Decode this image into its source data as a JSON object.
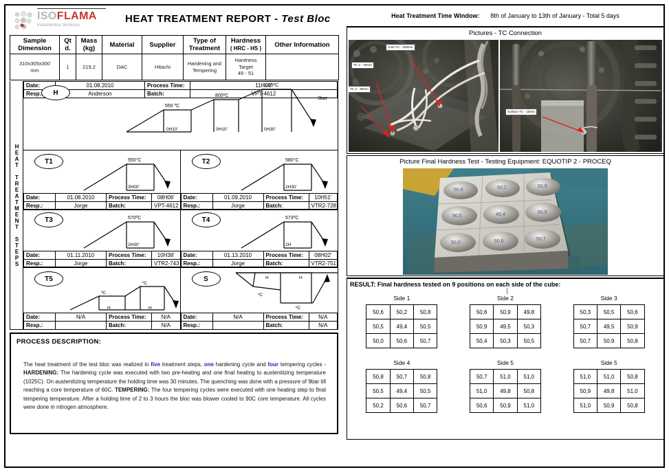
{
  "header": {
    "logo_main_part1": "ISO",
    "logo_main_part2": "FLAMA",
    "logo_sub": "tratamentos térmicos",
    "title": "HEAT  TREATMENT  REPORT - ",
    "sample_name": "Test Bloc",
    "time_window_label": "Heat Treatment Time Window:",
    "time_window_value": "8th of January to 13th of January - Total 5 days"
  },
  "spec_table": {
    "columns": [
      {
        "line1": "Sample",
        "line2": "Dimension"
      },
      {
        "line1": "Qt",
        "line2": "d."
      },
      {
        "line1": "Mass",
        "line2": "(kg)"
      },
      {
        "line1": "Material",
        "line2": ""
      },
      {
        "line1": "Supplier",
        "line2": ""
      },
      {
        "line1": "Type of",
        "line2": "Treatment"
      },
      {
        "line1": "Hardness",
        "line2": "( HRC - HS )"
      },
      {
        "line1": "Other Information",
        "line2": ""
      }
    ],
    "row": {
      "dimension": "310x305x300\nmm",
      "qty": "1",
      "mass": "219,2",
      "material": "DAC",
      "supplier": "Hitachi",
      "treatment": "Hardening and\nTempering",
      "hardness": "Hardness\nTarget\n49 - 51",
      "other": ""
    }
  },
  "steps_section": {
    "vertical_label": "HEAT TREATMENT STEPS",
    "labels": {
      "date": "Date:",
      "resp": "Resp.:",
      "process_time": "Process Time:",
      "batch": "Batch:"
    },
    "steps": [
      {
        "badge": "H",
        "date": "01.08.2010",
        "process_time": "11H06'",
        "resp": "Anderson",
        "batch": "VPT-4612",
        "chart": {
          "plateau_temps": [
            "550 ºC",
            "800ºC",
            "1025ºC"
          ],
          "hold_times": [
            "0H10'",
            "0H10'",
            "0H30'"
          ],
          "quench": "9bar"
        }
      },
      {
        "badge": "T1",
        "date": "01.08.2010",
        "process_time": "08H06'",
        "resp": "Jorge",
        "batch": "VPT-4612",
        "chart": {
          "temp": "550°C",
          "hold": "3H00'"
        }
      },
      {
        "badge": "T2",
        "date": "01.09.2010",
        "process_time": "10H51'",
        "resp": "Jorge",
        "batch": "VTR2-728",
        "chart": {
          "temp": "580°C",
          "hold": "2H30'"
        }
      },
      {
        "badge": "T3",
        "date": "01.11.2010",
        "process_time": "10H38'",
        "resp": "Jorge",
        "batch": "VTR2-743",
        "chart": {
          "temp": "570ºC",
          "hold": "2H30'"
        }
      },
      {
        "badge": "T4",
        "date": "01.13.2010",
        "process_time": "08H02'",
        "resp": "Jorge",
        "batch": "VTR2-751",
        "chart": {
          "temp": "573ºC",
          "hold": "2H"
        }
      },
      {
        "badge": "T5",
        "date": "N/A",
        "process_time": "N/A",
        "resp": "",
        "batch": "N/A",
        "chart": {
          "t1": "ºC",
          "t2": "ºC",
          "h1": "H",
          "h2": "H"
        }
      },
      {
        "badge": "S",
        "date": "N/A",
        "process_time": "N/A",
        "resp": "",
        "batch": "N/A",
        "chart": {
          "h1": "H",
          "h2": "H",
          "t1": "ºC",
          "t2": "ºC"
        }
      }
    ]
  },
  "process_description": {
    "title": "PROCESS DESCRIPTION:",
    "segments": [
      {
        "text": "The heat treatment of the test bloc was  realized in ",
        "style": "normal"
      },
      {
        "text": "five",
        "style": "highlight"
      },
      {
        "text": " treatment steps, ",
        "style": "normal"
      },
      {
        "text": "one",
        "style": "highlight"
      },
      {
        "text": " hardening cycle and ",
        "style": "normal"
      },
      {
        "text": "four",
        "style": "highlight"
      },
      {
        "text": " tempering cycles - ",
        "style": "normal"
      },
      {
        "text": "HARDENING:",
        "style": "bold"
      },
      {
        "text": " The hardening cycle was executed with two pre-heating and one final heating to austenitizing temperature (1025C). On austenitizing temperature the holding time was 30 minutes. The quenching was done with a pressure of 9bar till reaching a core temperature of 60C. ",
        "style": "normal"
      },
      {
        "text": "TEMPERING:",
        "style": "bold"
      },
      {
        "text": " The four tempering cycles were executed with one heating step to final tempering temperature. After a holding time of 2 to 3 hours the bloc was blower cooled to 90C core temperature. All cycles were done in nitrogen atmosphere.",
        "style": "normal"
      }
    ]
  },
  "pictures": {
    "tc_caption": "Pictures - TC Connection",
    "tc_labels": [
      "Core TC - 150mm",
      "TC 2 - 75mm",
      "TC 3 - 39mm",
      "Surface TC - 10mm"
    ],
    "hardness_caption": "Picture Final Hardness Test - Testing Equipment: EQUOTIP 2 - PROCEQ"
  },
  "result": {
    "title": "RESULT: Final hardness tested on 9 positions on each side of the cube:",
    "sides": [
      {
        "label": "Side 1",
        "values": [
          [
            "50,6",
            "50,2",
            "50,8"
          ],
          [
            "50,5",
            "49,4",
            "50,5"
          ],
          [
            "50,0",
            "50,6",
            "50,7"
          ]
        ]
      },
      {
        "label": "Side 2",
        "values": [
          [
            "50,6",
            "50,9",
            "49,8"
          ],
          [
            "50,9",
            "49,5",
            "50,3"
          ],
          [
            "50,4",
            "50,3",
            "50,5"
          ]
        ]
      },
      {
        "label": "Side 3",
        "values": [
          [
            "50,3",
            "50,5",
            "50,6"
          ],
          [
            "50,7",
            "49,5",
            "50,9"
          ],
          [
            "50,7",
            "50,9",
            "50,8"
          ]
        ]
      },
      {
        "label": "Side 4",
        "values": [
          [
            "50,8",
            "50,7",
            "50,8"
          ],
          [
            "50,5",
            "49,4",
            "50,5"
          ],
          [
            "50,2",
            "50,6",
            "50,7"
          ]
        ]
      },
      {
        "label": "Side 5",
        "values": [
          [
            "50,7",
            "51,0",
            "51,0"
          ],
          [
            "51,0",
            "49,8",
            "50,8"
          ],
          [
            "50,6",
            "50,9",
            "51,0"
          ]
        ]
      },
      {
        "label": "Side 5",
        "values": [
          [
            "51,0",
            "51,0",
            "50,8"
          ],
          [
            "50,9",
            "49,8",
            "51,0"
          ],
          [
            "51,0",
            "50,9",
            "50,8"
          ]
        ]
      }
    ]
  },
  "colors": {
    "accent_red": "#c0392b",
    "highlight_blue": "#2222cc",
    "border": "#000000"
  }
}
